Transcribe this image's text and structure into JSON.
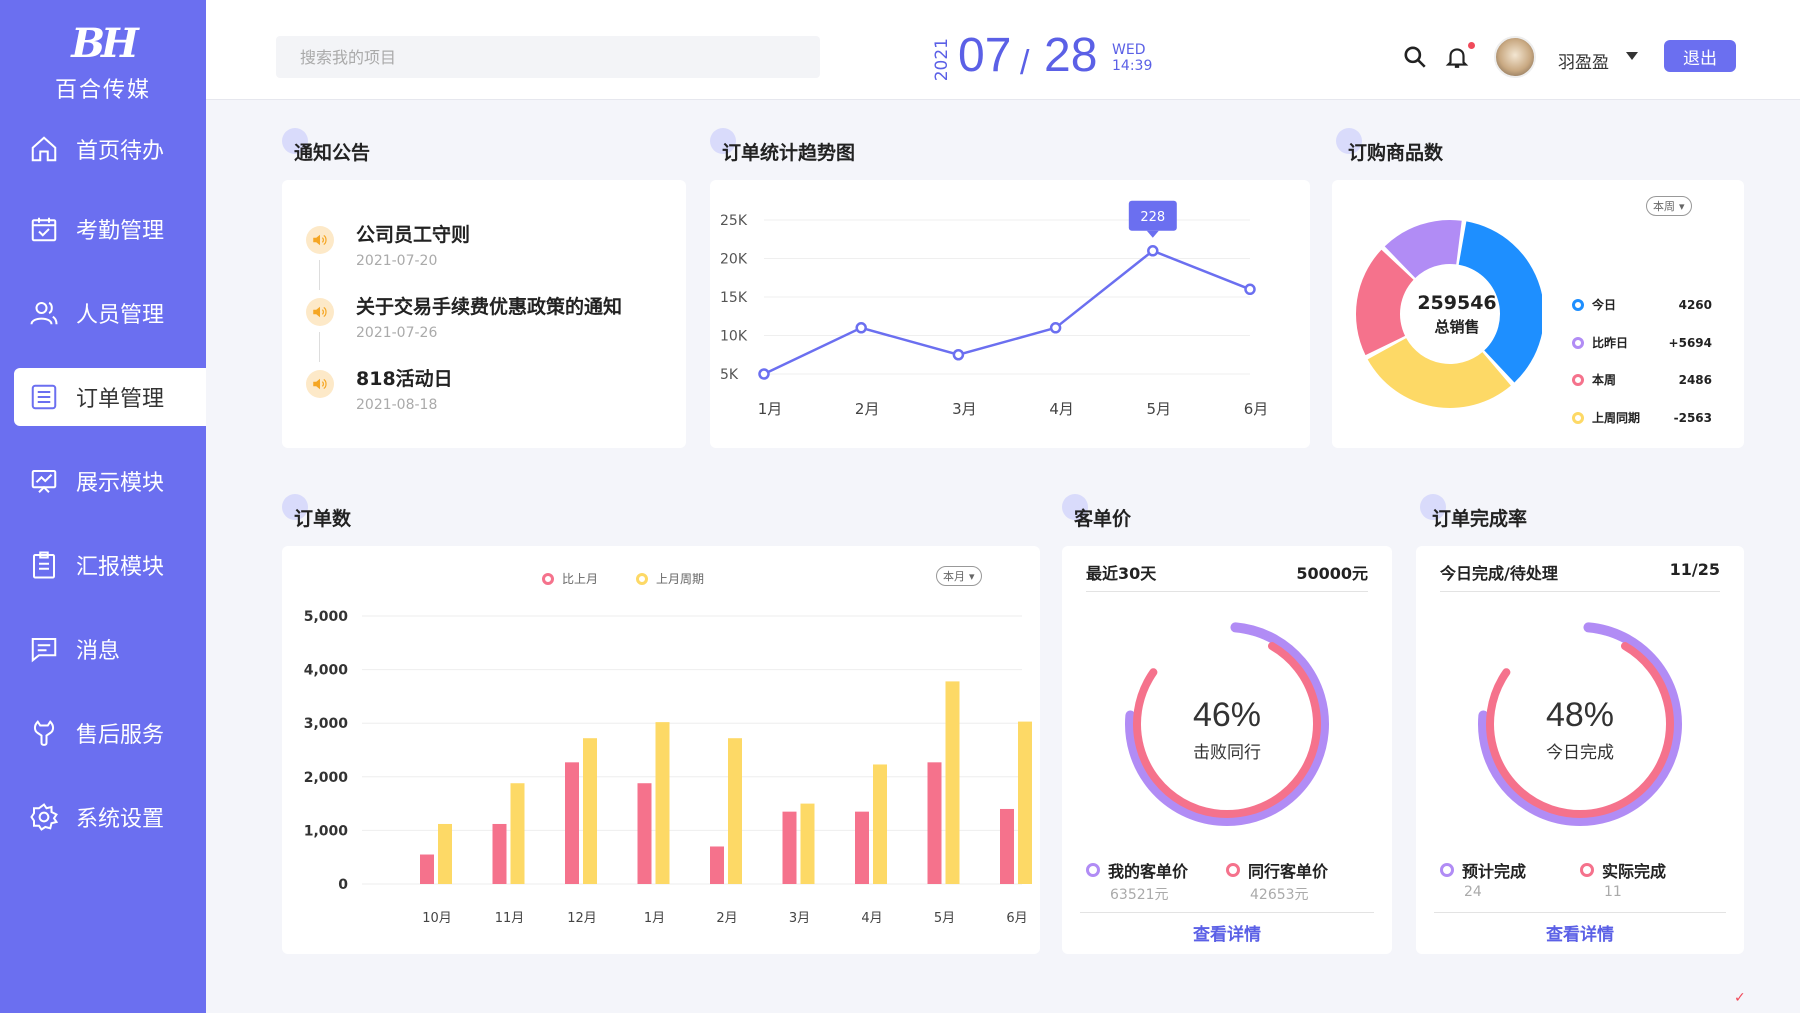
{
  "app": {
    "logo_mark": "BH",
    "name": "百合传媒"
  },
  "sidebar": {
    "items": [
      {
        "label": "首页待办",
        "icon": "home-icon"
      },
      {
        "label": "考勤管理",
        "icon": "calendar-check-icon"
      },
      {
        "label": "人员管理",
        "icon": "users-icon"
      },
      {
        "label": "订单管理",
        "icon": "list-icon",
        "active": true
      },
      {
        "label": "展示模块",
        "icon": "presentation-icon"
      },
      {
        "label": "汇报模块",
        "icon": "clipboard-icon"
      },
      {
        "label": "消息",
        "icon": "message-icon"
      },
      {
        "label": "售后服务",
        "icon": "service-icon"
      },
      {
        "label": "系统设置",
        "icon": "gear-icon"
      }
    ]
  },
  "header": {
    "search_placeholder": "搜索我的项目",
    "year": "2021",
    "month": "07",
    "day": "28",
    "weekday": "WED",
    "time": "14:39",
    "username": "羽盈盈",
    "logout": "退出"
  },
  "notice": {
    "title": "通知公告",
    "items": [
      {
        "title": "公司员工守则",
        "date": "2021-07-20"
      },
      {
        "title": "关于交易手续费优惠政策的通知",
        "date": "2021-07-26"
      },
      {
        "title": "818活动日",
        "date": "2021-08-18"
      }
    ]
  },
  "trend": {
    "title": "订单统计趋势图",
    "tooltip": "228"
  },
  "goods": {
    "title": "订购商品数",
    "filter": "本周",
    "total": "259546",
    "total_label": "总销售",
    "legend": [
      {
        "label": "今日",
        "value": "4260",
        "color": "#1e8fff"
      },
      {
        "label": "比昨日",
        "value": "+5694",
        "color": "#b18cf5"
      },
      {
        "label": "本周",
        "value": "2486",
        "color": "#f5728c"
      },
      {
        "label": "上周同期",
        "value": "-2563",
        "color": "#fdd966"
      }
    ]
  },
  "orders": {
    "title": "订单数",
    "filter": "本月",
    "legend": [
      {
        "label": "比上月",
        "color": "#f5728c"
      },
      {
        "label": "上月周期",
        "color": "#fdd966"
      }
    ]
  },
  "unit_price": {
    "title": "客单价",
    "period": "最近30天",
    "amount": "50000元",
    "percent": "46%",
    "percent_label": "击败同行",
    "legend": [
      {
        "label": "我的客单价",
        "value": "63521元",
        "color": "#b18cf5"
      },
      {
        "label": "同行客单价",
        "value": "42653元",
        "color": "#f5728c"
      }
    ],
    "link": "查看详情"
  },
  "completion": {
    "title": "订单完成率",
    "period": "今日完成/待处理",
    "amount": "11/25",
    "percent": "48%",
    "percent_label": "今日完成",
    "legend": [
      {
        "label": "预计完成",
        "value": "24",
        "color": "#b18cf5"
      },
      {
        "label": "实际完成",
        "value": "11",
        "color": "#f5728c"
      }
    ],
    "link": "查看详情"
  },
  "chart_data": [
    {
      "type": "line",
      "title": "订单统计趋势图",
      "categories": [
        "1月",
        "2月",
        "3月",
        "4月",
        "5月",
        "6月"
      ],
      "series": [
        {
          "values": [
            5000,
            11000,
            7500,
            11000,
            21000,
            16000
          ]
        }
      ],
      "y_ticks": [
        "5K",
        "10K",
        "15K",
        "20K",
        "25K"
      ],
      "ylim": [
        5000,
        25000
      ],
      "annotation": "228",
      "color": "#6b6ff0"
    },
    {
      "type": "pie",
      "title": "订购商品数",
      "labels": [
        "今日",
        "上周同期",
        "本周",
        "比昨日"
      ],
      "values": [
        36,
        29,
        20,
        15
      ],
      "colors": [
        "#1e8fff",
        "#fdd966",
        "#f5728c",
        "#b18cf5"
      ]
    },
    {
      "type": "bar",
      "title": "订单数",
      "categories": [
        "10月",
        "11月",
        "12月",
        "1月",
        "2月",
        "3月",
        "4月",
        "5月",
        "6月"
      ],
      "series": [
        {
          "name": "比上月",
          "values": [
            550,
            1120,
            2270,
            1880,
            700,
            1350,
            1350,
            2270,
            1400
          ],
          "color": "#f5728c"
        },
        {
          "name": "上月周期",
          "values": [
            1120,
            1880,
            2720,
            3020,
            2720,
            1500,
            2230,
            3780,
            3030
          ],
          "color": "#fdd966"
        }
      ],
      "y_ticks": [
        "0",
        "1,000",
        "2,000",
        "3,000",
        "4,000",
        "5,000"
      ],
      "ylim": [
        0,
        5000
      ]
    }
  ]
}
